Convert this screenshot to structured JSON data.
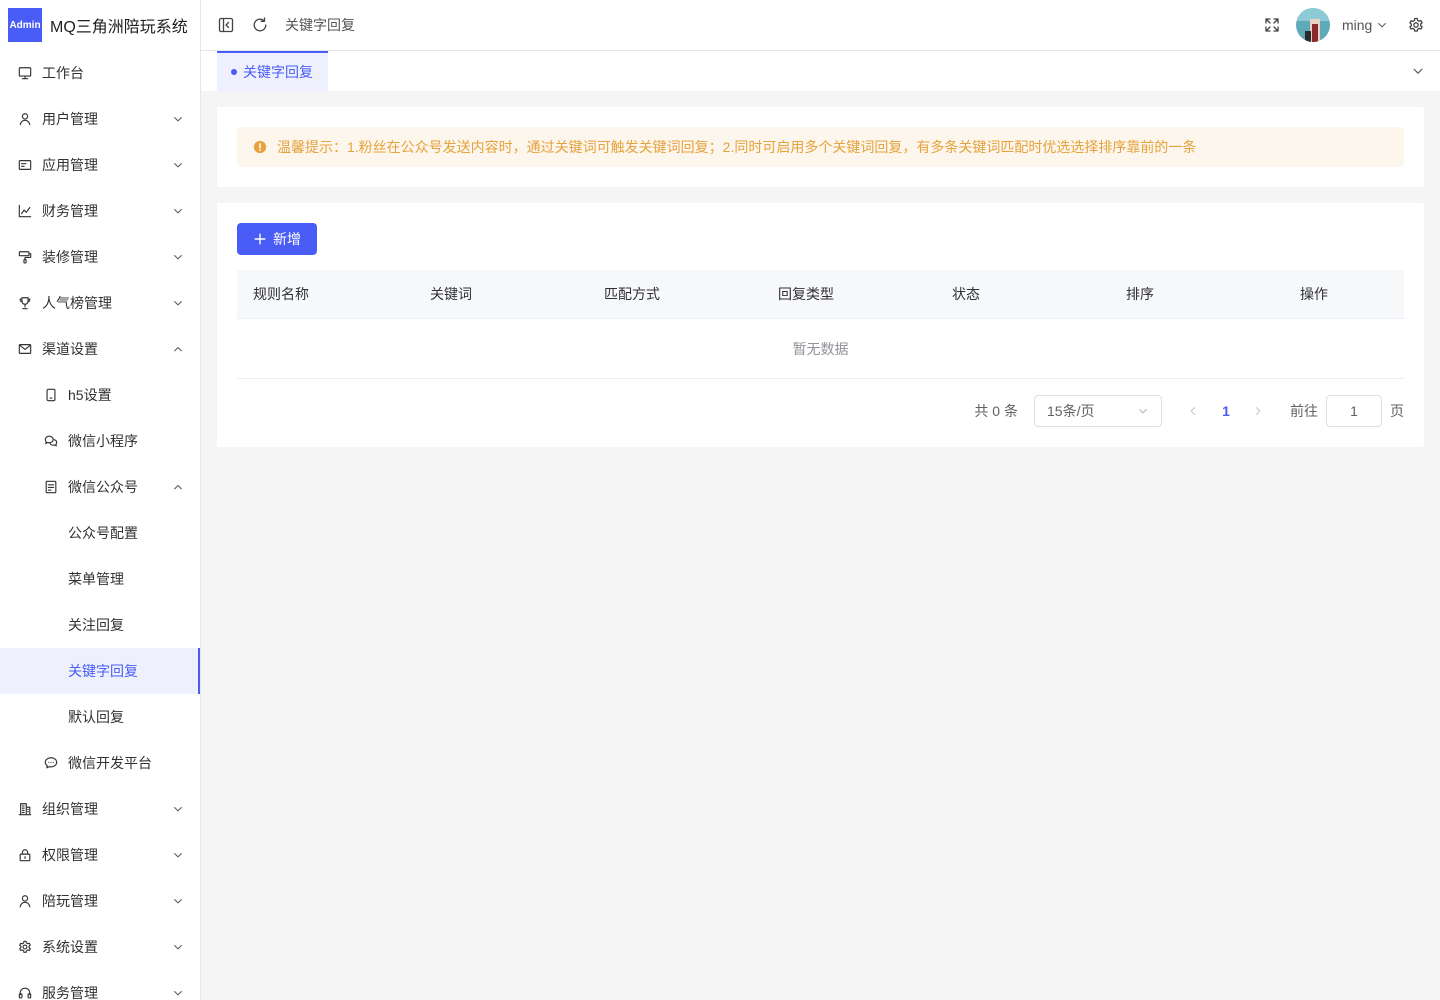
{
  "app": {
    "logo_text": "Admin",
    "title": "MQ三角洲陪玩系统"
  },
  "sidebar": {
    "items": [
      {
        "label": "工作台",
        "icon": "monitor-icon"
      },
      {
        "label": "用户管理",
        "icon": "user-icon",
        "expanded": false
      },
      {
        "label": "应用管理",
        "icon": "app-card-icon",
        "expanded": false
      },
      {
        "label": "财务管理",
        "icon": "finance-chart-icon",
        "expanded": false
      },
      {
        "label": "装修管理",
        "icon": "paint-roller-icon",
        "expanded": false
      },
      {
        "label": "人气榜管理",
        "icon": "trophy-icon",
        "expanded": false
      },
      {
        "label": "渠道设置",
        "icon": "mail-icon",
        "expanded": true
      },
      {
        "label": "h5设置",
        "icon": "mobile-icon"
      },
      {
        "label": "微信小程序",
        "icon": "mini-program-icon"
      },
      {
        "label": "微信公众号",
        "icon": "document-icon",
        "expanded": true
      },
      {
        "label": "公众号配置"
      },
      {
        "label": "菜单管理"
      },
      {
        "label": "关注回复"
      },
      {
        "label": "关键字回复",
        "active": true
      },
      {
        "label": "默认回复"
      },
      {
        "label": "微信开发平台",
        "icon": "chat-icon"
      },
      {
        "label": "组织管理",
        "icon": "building-icon",
        "expanded": false
      },
      {
        "label": "权限管理",
        "icon": "lock-icon",
        "expanded": false
      },
      {
        "label": "陪玩管理",
        "icon": "user-icon",
        "expanded": false
      },
      {
        "label": "系统设置",
        "icon": "gear-icon",
        "expanded": false
      },
      {
        "label": "服务管理",
        "icon": "headset-icon",
        "expanded": false
      }
    ]
  },
  "header": {
    "breadcrumb": "关键字回复",
    "username": "ming"
  },
  "tabs": [
    {
      "label": "关键字回复",
      "active": true
    }
  ],
  "notice": {
    "icon": "warning-icon",
    "text": "温馨提示：1.粉丝在公众号发送内容时，通过关键词可触发关键词回复；2.同时可启用多个关键词回复，有多条关键词匹配时优选选择排序靠前的一条"
  },
  "toolbar": {
    "add_label": "新增",
    "add_icon": "plus-icon"
  },
  "table": {
    "columns": [
      "规则名称",
      "关键词",
      "匹配方式",
      "回复类型",
      "状态",
      "排序",
      "操作"
    ],
    "rows": [],
    "empty_text": "暂无数据"
  },
  "pagination": {
    "total_text": "共 0 条",
    "page_size": "15条/页",
    "current_page": "1",
    "goto_label": "前往",
    "goto_value": "1",
    "page_suffix": "页"
  },
  "colors": {
    "accent": "#4a5cf6",
    "warning": "#e6a23c",
    "warning_bg": "#fdf6ec",
    "active_bg": "#eef0fe"
  }
}
